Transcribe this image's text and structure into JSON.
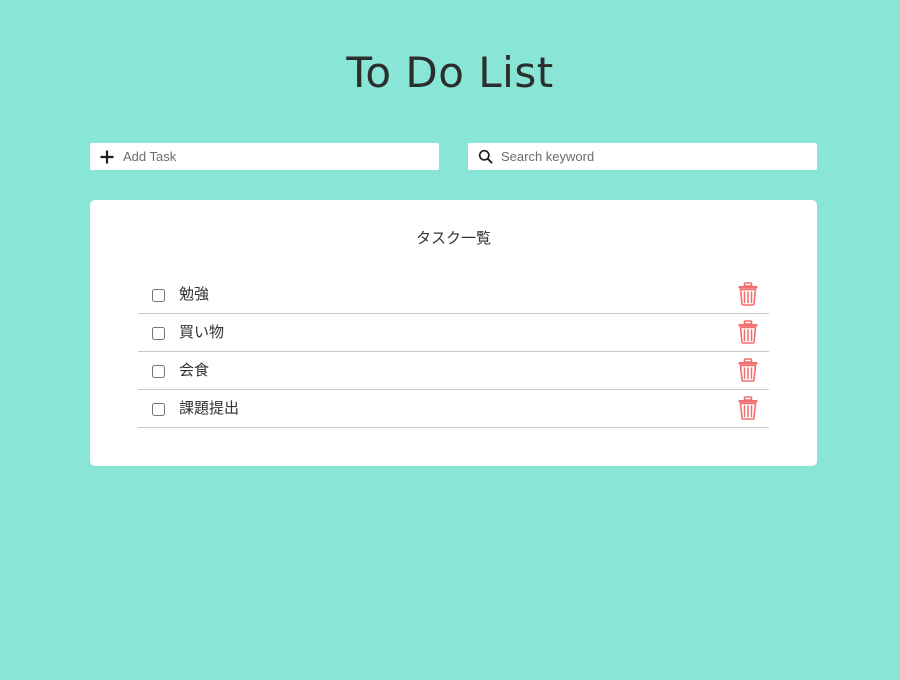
{
  "page": {
    "title": "To Do List"
  },
  "add_task": {
    "placeholder": "Add Task",
    "value": ""
  },
  "search": {
    "placeholder": "Search keyword",
    "value": ""
  },
  "task_panel": {
    "heading": "タスク一覧",
    "tasks": [
      {
        "label": "勉強",
        "checked": false
      },
      {
        "label": "買い物",
        "checked": false
      },
      {
        "label": "会食",
        "checked": false
      },
      {
        "label": "課題提出",
        "checked": false
      }
    ]
  },
  "icons": {
    "add": "plus-icon",
    "search": "search-icon",
    "delete": "trash-icon"
  },
  "colors": {
    "background": "#89e5d6",
    "panel": "#ffffff",
    "delete_icon": "#f26d6d",
    "text": "#2b2b2b"
  }
}
